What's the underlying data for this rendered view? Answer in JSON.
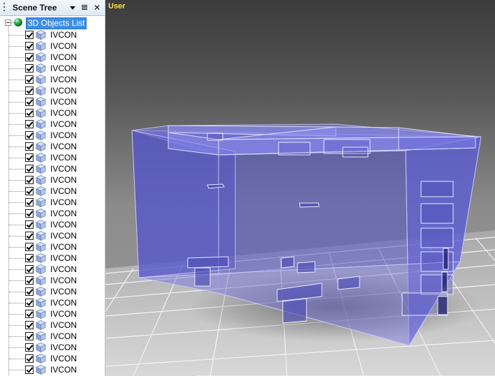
{
  "panel": {
    "title": "Scene Tree",
    "root_label": "3D Objects List",
    "item_label": "IVCON",
    "item_count": 31,
    "icons": {
      "grip": "grip-icon",
      "dropdown": "dropdown-arrow-icon",
      "list": "list-options-icon",
      "close": "close-icon",
      "root": "globe-icon",
      "item": "cube-icon",
      "checkbox": "checked-checkbox"
    }
  },
  "viewport": {
    "label": "User"
  },
  "colors": {
    "viewport_label": "#f6e93a",
    "selection": "#3d8ee6",
    "box_fill": "#5a5acf"
  }
}
